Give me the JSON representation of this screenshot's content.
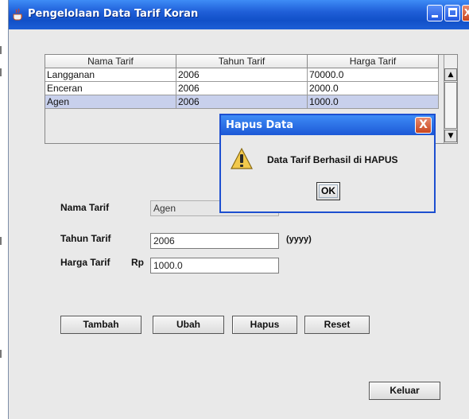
{
  "window": {
    "title": "Pengelolaan Data Tarif Koran",
    "min_label": "",
    "max_label": "",
    "close_label": "X"
  },
  "table": {
    "columns": [
      "Nama Tarif",
      "Tahun Tarif",
      "Harga Tarif"
    ],
    "rows": [
      [
        "Langganan",
        "2006",
        "70000.0"
      ],
      [
        "Enceran",
        "2006",
        "2000.0"
      ],
      [
        "Agen",
        "2006",
        "1000.0"
      ]
    ],
    "selected_row": 2
  },
  "form": {
    "nama_label": "Nama Tarif",
    "nama_value": "Agen",
    "tahun_label": "Tahun Tarif",
    "tahun_value": "2006",
    "tahun_hint": "(yyyy)",
    "harga_label": "Harga Tarif",
    "harga_prefix": "Rp",
    "harga_value": "1000.0"
  },
  "buttons": {
    "tambah": "Tambah",
    "ubah": "Ubah",
    "hapus": "Hapus",
    "reset": "Reset",
    "keluar": "Keluar"
  },
  "dialog": {
    "title": "Hapus Data",
    "close_label": "X",
    "message": "Data Tarif Berhasil di HAPUS",
    "ok_label": "OK",
    "icon": "warning-icon"
  },
  "colors": {
    "titlebar": "#1f5fd8",
    "selected_row": "#c8d0ec",
    "close_button": "#c9461f"
  }
}
